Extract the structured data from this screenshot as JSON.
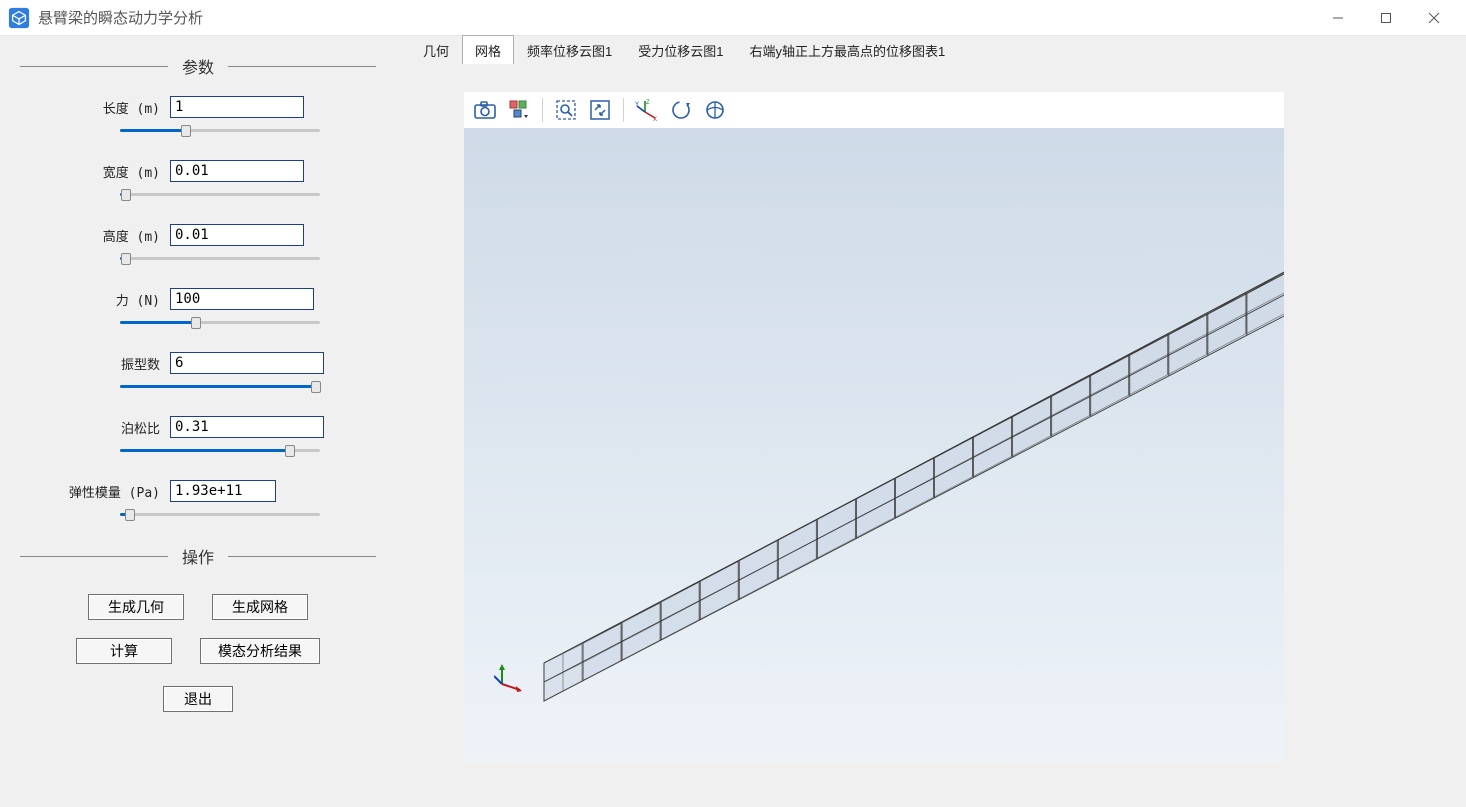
{
  "window": {
    "title": "悬臂梁的瞬态动力学分析"
  },
  "sections": {
    "params_title": "参数",
    "actions_title": "操作"
  },
  "params": {
    "length": {
      "label": "长度 (m)",
      "value": "1",
      "slider_pct": 33
    },
    "width": {
      "label": "宽度 (m)",
      "value": "0.01",
      "slider_pct": 3
    },
    "height": {
      "label": "高度 (m)",
      "value": "0.01",
      "slider_pct": 3
    },
    "force": {
      "label": "力 (N)",
      "value": "100",
      "slider_pct": 38
    },
    "modes": {
      "label": "振型数",
      "value": "6",
      "slider_pct": 98
    },
    "poisson": {
      "label": "泊松比",
      "value": "0.31",
      "slider_pct": 85
    },
    "young": {
      "label": "弹性模量 (Pa)",
      "value": "1.93e+11",
      "slider_pct": 5
    }
  },
  "actions": {
    "gen_geom": "生成几何",
    "gen_mesh": "生成网格",
    "compute": "计算",
    "modal": "模态分析结果",
    "exit": "退出"
  },
  "tabs": {
    "items": [
      {
        "label": "几何",
        "active": false
      },
      {
        "label": "网格",
        "active": true
      },
      {
        "label": "频率位移云图1",
        "active": false
      },
      {
        "label": "受力位移云图1",
        "active": false
      },
      {
        "label": "右端y轴正上方最高点的位移图表1",
        "active": false
      }
    ]
  },
  "toolbar_icons": {
    "snapshot": "camera-icon",
    "scene": "scene-select-icon",
    "zoom_box": "zoom-box-icon",
    "zoom_extents": "zoom-extents-icon",
    "axes": "axes-icon",
    "rotate": "rotate-icon",
    "orbit": "orbit-icon"
  }
}
